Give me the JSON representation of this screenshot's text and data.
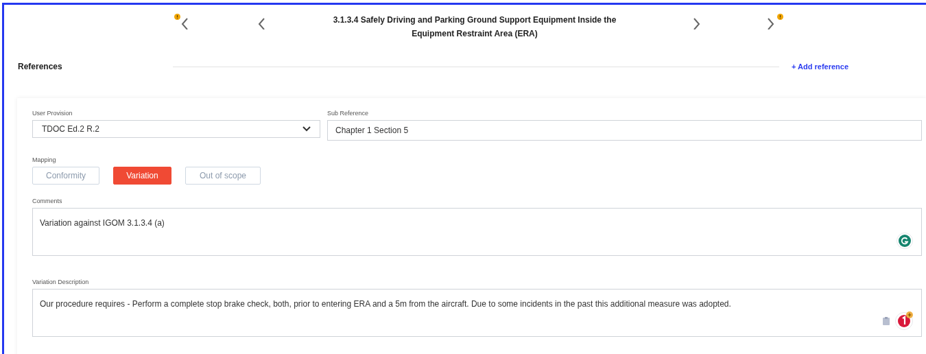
{
  "navigation": {
    "title": "3.1.3.4 Safely Driving and Parking Ground Support Equipment Inside the Equipment Restraint Area (ERA)",
    "buttons": [
      {
        "kind": "first",
        "warning": true
      },
      {
        "kind": "previous",
        "warning": false
      },
      {
        "kind": "next",
        "warning": false
      },
      {
        "kind": "last",
        "warning": true
      }
    ]
  },
  "references": {
    "heading": "References",
    "add_link": "+ Add reference"
  },
  "form": {
    "user_provision": {
      "label": "User Provision",
      "value": "TDOC Ed.2 R.2"
    },
    "sub_reference": {
      "label": "Sub Reference",
      "value": "Chapter 1 Section 5"
    },
    "mapping": {
      "label": "Mapping",
      "options": [
        {
          "label": "Conformity",
          "selected": false
        },
        {
          "label": "Variation",
          "selected": true
        },
        {
          "label": "Out of scope",
          "selected": false
        }
      ]
    },
    "comments": {
      "label": "Comments",
      "value": "Variation against IGOM 3.1.3.4 (a)"
    },
    "variation_description": {
      "label": "Variation Description",
      "value": "Our procedure requires - Perform a complete stop brake check, both, prior to entering ERA and a 5m from the aircraft. Due to some incidents in the past this additional measure was adopted."
    }
  }
}
